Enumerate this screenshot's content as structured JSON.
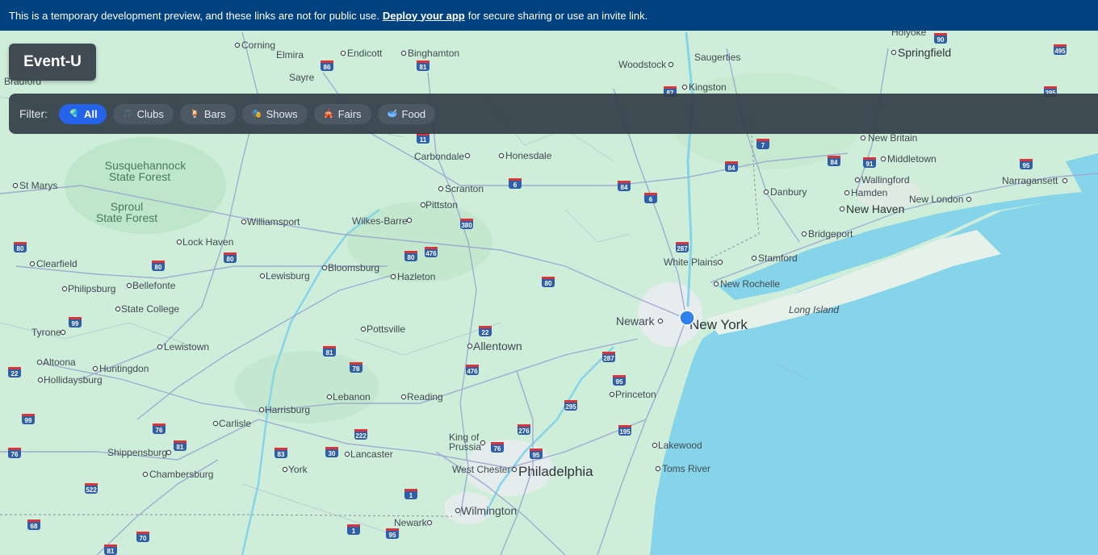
{
  "banner": {
    "text_before": "This is a temporary development preview, and these links are not for public use.",
    "link_text": "Deploy your app",
    "text_after": "for secure sharing or use an invite link."
  },
  "app": {
    "title": "Event-U"
  },
  "filter": {
    "label": "Filter:",
    "chips": [
      {
        "label": "All",
        "icon": "globe-icon",
        "active": true
      },
      {
        "label": "Clubs",
        "icon": "music-note-icon",
        "active": false
      },
      {
        "label": "Bars",
        "icon": "drink-icon",
        "active": false
      },
      {
        "label": "Shows",
        "icon": "theater-masks-icon",
        "active": false
      },
      {
        "label": "Fairs",
        "icon": "ferris-wheel-icon",
        "active": false
      },
      {
        "label": "Food",
        "icon": "bowl-icon",
        "active": false
      }
    ]
  },
  "map": {
    "land_color": "#cfeeda",
    "water_color": "#86d4ea",
    "road_color": "#9aa6cf",
    "marker_color": "#2f80ed",
    "cities": [
      {
        "name": "Corning"
      },
      {
        "name": "Elmira"
      },
      {
        "name": "Endicott"
      },
      {
        "name": "Binghamton"
      },
      {
        "name": "Sayre"
      },
      {
        "name": "Woodstock"
      },
      {
        "name": "Saugerties"
      },
      {
        "name": "Kingston"
      },
      {
        "name": "Holyoke"
      },
      {
        "name": "Springfield"
      },
      {
        "name": "Bradford"
      },
      {
        "name": "Carbondale"
      },
      {
        "name": "Honesdale"
      },
      {
        "name": "New Britain"
      },
      {
        "name": "Middletown"
      },
      {
        "name": "Wallingford"
      },
      {
        "name": "Narragansett"
      },
      {
        "name": "Danbury"
      },
      {
        "name": "Hamden"
      },
      {
        "name": "New London"
      },
      {
        "name": "New Haven"
      },
      {
        "name": "Scranton"
      },
      {
        "name": "Pittston"
      },
      {
        "name": "St Marys"
      },
      {
        "name": "Williamsport"
      },
      {
        "name": "Wilkes-Barre"
      },
      {
        "name": "Lock Haven"
      },
      {
        "name": "Bridgeport"
      },
      {
        "name": "Stamford"
      },
      {
        "name": "White Plains"
      },
      {
        "name": "New Rochelle"
      },
      {
        "name": "Clearfield"
      },
      {
        "name": "Bloomsburg"
      },
      {
        "name": "Lewisburg"
      },
      {
        "name": "Hazleton"
      },
      {
        "name": "Philipsburg"
      },
      {
        "name": "Bellefonte"
      },
      {
        "name": "State College"
      },
      {
        "name": "Long Island"
      },
      {
        "name": "Newark"
      },
      {
        "name": "New York"
      },
      {
        "name": "Tyrone"
      },
      {
        "name": "Pottsville"
      },
      {
        "name": "Allentown"
      },
      {
        "name": "Lewistown"
      },
      {
        "name": "Altoona"
      },
      {
        "name": "Huntingdon"
      },
      {
        "name": "Hollidaysburg"
      },
      {
        "name": "Princeton"
      },
      {
        "name": "Lebanon"
      },
      {
        "name": "Reading"
      },
      {
        "name": "Harrisburg"
      },
      {
        "name": "Carlisle"
      },
      {
        "name": "King of"
      },
      {
        "name": "Prussia"
      },
      {
        "name": "Lakewood"
      },
      {
        "name": "Shippensburg"
      },
      {
        "name": "Lancaster"
      },
      {
        "name": "West Chester"
      },
      {
        "name": "Philadelphia"
      },
      {
        "name": "Toms River"
      },
      {
        "name": "Chambersburg"
      },
      {
        "name": "York"
      },
      {
        "name": "Wilmington"
      },
      {
        "name": "Newark"
      }
    ],
    "regions": [
      {
        "name": "Susquehannock"
      },
      {
        "name": "State Forest"
      },
      {
        "name": "Sproul"
      },
      {
        "name": "State Forest"
      }
    ],
    "highways": [
      "86",
      "81",
      "90",
      "495",
      "395",
      "11",
      "84",
      "6",
      "7",
      "84",
      "91",
      "95",
      "84",
      "380",
      "6",
      "287",
      "80",
      "476",
      "80",
      "80",
      "80",
      "80",
      "99",
      "22",
      "81",
      "78",
      "287",
      "476",
      "95",
      "295",
      "76",
      "83",
      "81",
      "76",
      "30",
      "222",
      "276",
      "195",
      "99",
      "522",
      "1",
      "68",
      "70",
      "81",
      "95",
      "1",
      "76",
      "95",
      "22",
      "87"
    ]
  }
}
